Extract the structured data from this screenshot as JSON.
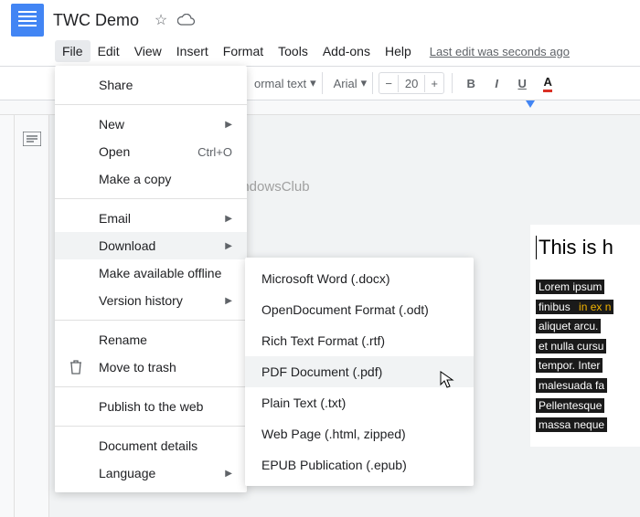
{
  "header": {
    "title": "TWC Demo",
    "last_edit": "Last edit was seconds ago"
  },
  "menubar": [
    "File",
    "Edit",
    "View",
    "Insert",
    "Format",
    "Tools",
    "Add-ons",
    "Help"
  ],
  "toolbar": {
    "style_label": "ormal text",
    "font_label": "Arial",
    "font_size": "20",
    "minus": "−",
    "plus": "+",
    "bold": "B",
    "italic": "I",
    "underline": "U",
    "color": "A"
  },
  "file_menu": {
    "share": "Share",
    "new": "New",
    "open": "Open",
    "open_kbd": "Ctrl+O",
    "make_copy": "Make a copy",
    "email": "Email",
    "download": "Download",
    "offline": "Make available offline",
    "version": "Version history",
    "rename": "Rename",
    "trash": "Move to trash",
    "publish": "Publish to the web",
    "details": "Document details",
    "language": "Language"
  },
  "download_submenu": [
    "Microsoft Word (.docx)",
    "OpenDocument Format (.odt)",
    "Rich Text Format (.rtf)",
    "PDF Document (.pdf)",
    "Plain Text (.txt)",
    "Web Page (.html, zipped)",
    "EPUB Publication (.epub)"
  ],
  "watermark": "TheWindowsClub",
  "document": {
    "heading": "This is h",
    "lines": [
      {
        "t": "Lorem ipsum"
      },
      {
        "t": "finibus ",
        "hl": "in ex n"
      },
      {
        "t": "aliquet arcu."
      },
      {
        "t": "et nulla cursu"
      },
      {
        "t": "tempor. Inter"
      },
      {
        "t": "malesuada fa"
      },
      {
        "t": "Pellentesque"
      },
      {
        "t": "massa neque"
      }
    ]
  }
}
